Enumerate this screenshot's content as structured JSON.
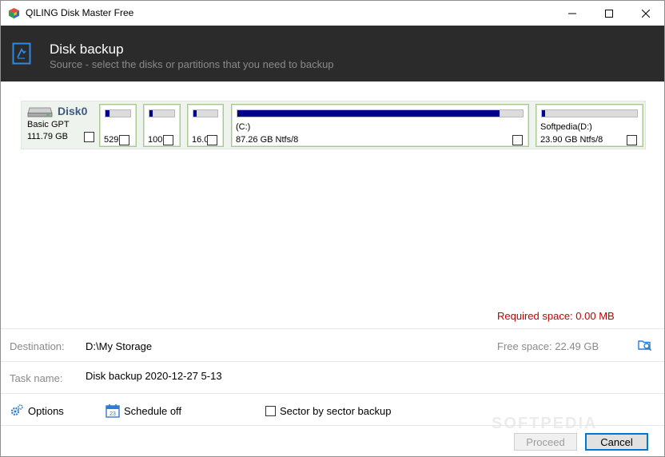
{
  "window": {
    "title": "QILING Disk Master Free",
    "controls": {
      "minimize": "minimize-icon",
      "maximize": "maximize-icon",
      "close": "close-icon"
    }
  },
  "header": {
    "title": "Disk backup",
    "subtitle": "Source - select the disks or partitions that you need to backup",
    "icon": "backup-document-icon"
  },
  "disk": {
    "name": "Disk0",
    "type": "Basic GPT",
    "size": "111.79 GB",
    "checked": false,
    "partitions": [
      {
        "label": "",
        "size": "529",
        "used_fraction": 0.15,
        "checked": false
      },
      {
        "label": "",
        "size": "100",
        "used_fraction": 0.12,
        "checked": false
      },
      {
        "label": "",
        "size": "16.0",
        "used_fraction": 0.12,
        "checked": false
      },
      {
        "label": "(C:)",
        "size": "87.26 GB Ntfs/8",
        "used_fraction": 0.92,
        "checked": false
      },
      {
        "label": "Softpedia(D:)",
        "size": "23.90 GB Ntfs/8",
        "used_fraction": 0.03,
        "checked": false
      }
    ]
  },
  "required_space": "Required space: 0.00 MB",
  "destination": {
    "label": "Destination:",
    "value": "D:\\My Storage",
    "free_space": "Free space: 22.49 GB",
    "browse_icon": "browse-folder-icon"
  },
  "task": {
    "label": "Task name:",
    "value": "Disk backup 2020-12-27 5-13"
  },
  "options": {
    "options_label": "Options",
    "schedule_label": "Schedule off",
    "sector_label": "Sector by sector backup",
    "sector_checked": false
  },
  "buttons": {
    "proceed": "Proceed",
    "cancel": "Cancel"
  },
  "watermark": "SOFTPEDIA",
  "colors": {
    "header_bg": "#2b2b2b",
    "accent": "#0078d7",
    "required_text": "#c00000",
    "partition_border": "#a8c88f",
    "usage_fill": "#000090"
  }
}
